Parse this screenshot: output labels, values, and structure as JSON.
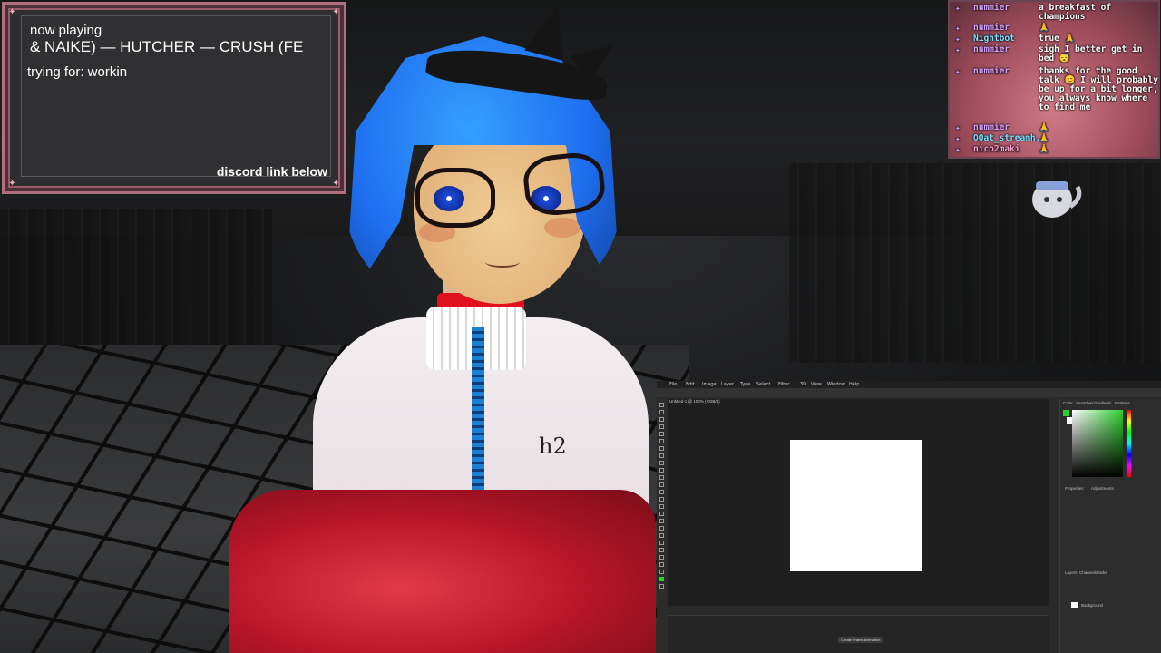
{
  "music": {
    "now_playing_label": "now playing",
    "song": "& NAIKE) — HUTCHER — CRUSH (FE",
    "goal": "trying for: workin",
    "discord": "discord link below"
  },
  "chat": [
    {
      "user": "nummier",
      "text": "a breakfast of champions"
    },
    {
      "user": "nummier",
      "text": "🙏"
    },
    {
      "user": "Nightbot",
      "text": "true 🙏"
    },
    {
      "user": "nummier",
      "text": "sigh I better get in bed 😴"
    },
    {
      "user": "nummier",
      "text": "thanks for the good talk 😊 I will probably be up for a bit longer, you always know where to find me"
    },
    {
      "user": "nummier",
      "text": "🙏"
    },
    {
      "user": "OOat_streamh..",
      "text": "🙏"
    },
    {
      "user": "nico2maki",
      "text": "🙏"
    }
  ],
  "avatar": {
    "shirt_logo": "h2"
  },
  "photoshop": {
    "menus": [
      "File",
      "Edit",
      "Image",
      "Layer",
      "Type",
      "Select",
      "Filter",
      "3D",
      "View",
      "Window",
      "Help"
    ],
    "doc_tab": "Untitled-1 @ 100% (RGB/8)",
    "panel_tabs": [
      "Color",
      "Swatches",
      "Gradients",
      "Patterns"
    ],
    "properties_label": "Properties",
    "adjustments_label": "Adjustments",
    "layers_label": "Layers",
    "channels_label": "Channels",
    "paths_label": "Paths",
    "layer_name": "Background",
    "timeline_button": "Create Frame Animation"
  }
}
